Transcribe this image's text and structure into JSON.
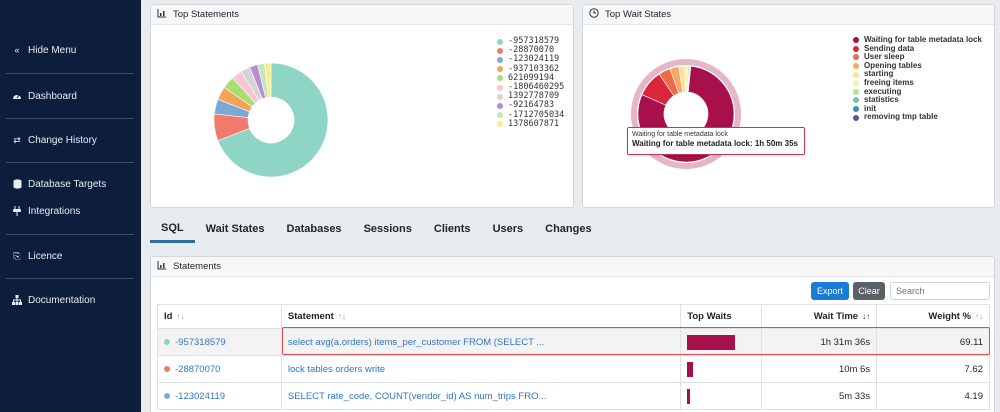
{
  "sidebar": {
    "items": [
      {
        "label": "Hide Menu",
        "icon": "double-chevron-left-icon"
      },
      {
        "label": "Dashboard",
        "icon": "dashboard-gauge-icon"
      },
      {
        "label": "Change History",
        "icon": "swap-arrows-icon"
      },
      {
        "label": "Database Targets",
        "icon": "database-icon"
      },
      {
        "label": "Integrations",
        "icon": "plug-icon"
      },
      {
        "label": "Licence",
        "icon": "sign-in-icon"
      },
      {
        "label": "Documentation",
        "icon": "sitemap-icon"
      }
    ]
  },
  "top_statements": {
    "title": "Top Statements",
    "legend": [
      "-957318579",
      "-28870070",
      "-123024119",
      "-937103362",
      "621099194",
      "-1806460295",
      "1392778709",
      "-92164783",
      "-1712705034",
      "1378607871"
    ],
    "colors": [
      "#8fd5c5",
      "#f07a6b",
      "#7aa9d6",
      "#f5a35c",
      "#a8dd70",
      "#f6c5d1",
      "#d4d4d4",
      "#b18fd1",
      "#c8e6b5",
      "#f7ee8f"
    ]
  },
  "top_wait_states": {
    "title": "Top Wait States",
    "legend": [
      "Waiting for table metadata lock",
      "Sending data",
      "User sleep",
      "Opening tables",
      "starting",
      "freeing items",
      "executing",
      "statistics",
      "init",
      "removing tmp table"
    ],
    "colors": [
      "#a8104b",
      "#d9263d",
      "#ef6a48",
      "#f8a765",
      "#fde19a",
      "#eef5ad",
      "#b4e1a0",
      "#6dc4a4",
      "#3b8ebd",
      "#5e4fa2"
    ],
    "tooltip_title": "Waiting for table metadata lock",
    "tooltip_value": "Waiting for table metadata lock: 1h 50m 35s"
  },
  "tabs": [
    "SQL",
    "Wait States",
    "Databases",
    "Sessions",
    "Clients",
    "Users",
    "Changes"
  ],
  "statements": {
    "title": "Statements",
    "export_label": "Export",
    "clear_label": "Clear",
    "search_placeholder": "Search",
    "columns": {
      "id": "Id",
      "statement": "Statement",
      "top_waits": "Top Waits",
      "wait_time": "Wait Time",
      "weight": "Weight %"
    },
    "rows": [
      {
        "id": "-957318579",
        "statement": "select avg(a.orders) items_per_customer FROM (SELECT ...",
        "wait_time": "1h 31m 36s",
        "weight": "69.11",
        "dot_color": "#8fd5c5",
        "bar_fraction": 0.6911
      },
      {
        "id": "-28870070",
        "statement": "lock tables orders write",
        "wait_time": "10m 6s",
        "weight": "7.62",
        "dot_color": "#f07a6b",
        "bar_fraction": 0.0762
      },
      {
        "id": "-123024119",
        "statement": "SELECT rate_code, COUNT(vendor_id) AS num_trips FRO...",
        "wait_time": "5m 33s",
        "weight": "4.19",
        "dot_color": "#7aa9d6",
        "bar_fraction": 0.0419
      }
    ]
  }
}
